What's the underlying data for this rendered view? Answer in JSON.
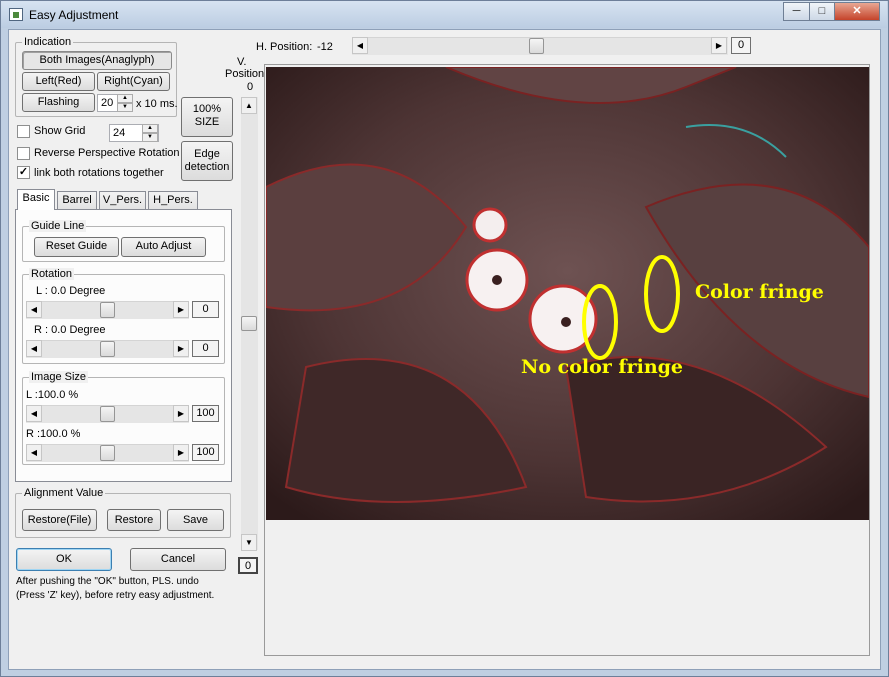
{
  "window": {
    "title": "Easy Adjustment",
    "min": "─",
    "max": "□",
    "close": "✕"
  },
  "indication": {
    "label": "Indication",
    "both": "Both Images(Anaglyph)",
    "left": "Left(Red)",
    "right": "Right(Cyan)",
    "flashing": "Flashing",
    "flash_value": "20",
    "flash_unit": "x 10 ms."
  },
  "size_button": {
    "line1": "100%",
    "line2": "SIZE"
  },
  "edge_button": {
    "line1": "Edge",
    "line2": "detection"
  },
  "show_grid": {
    "label": "Show Grid",
    "checked": false,
    "value": "24"
  },
  "reverse_perspective": {
    "label": "Reverse Perspective Rotation",
    "checked": false
  },
  "link_rotations": {
    "label": "link both rotations together",
    "checked": true
  },
  "tabs": [
    "Basic",
    "Barrel",
    "V_Pers.",
    "H_Pers."
  ],
  "guide_line": {
    "label": "Guide Line",
    "reset": "Reset Guide",
    "auto": "Auto Adjust"
  },
  "rotation": {
    "label": "Rotation",
    "l_text": "L : 0.0 Degree",
    "l_value": "0",
    "r_text": "R : 0.0 Degree",
    "r_value": "0"
  },
  "image_size": {
    "label": "Image Size",
    "l_text": "L :100.0 %",
    "l_value": "100",
    "r_text": "R :100.0 %",
    "r_value": "100"
  },
  "alignment": {
    "label": "Alignment Value",
    "restore_file": "Restore(File)",
    "restore": "Restore",
    "save": "Save"
  },
  "ok": "OK",
  "cancel": "Cancel",
  "note_line1": "After pushing the \"OK\" button, PLS. undo",
  "note_line2": "(Press 'Z' key), before retry easy adjustment.",
  "h_position": {
    "label": "H. Position:",
    "value": "-12",
    "button": "0"
  },
  "v_position": {
    "label1": "V.",
    "label2": "Position",
    "value": "0",
    "button": "0"
  },
  "annotations": {
    "color_fringe": "Color fringe",
    "no_color_fringe": "No color fringe"
  },
  "colors": {
    "annotation": "#ffff00",
    "photo_tint": "#6a4848"
  }
}
